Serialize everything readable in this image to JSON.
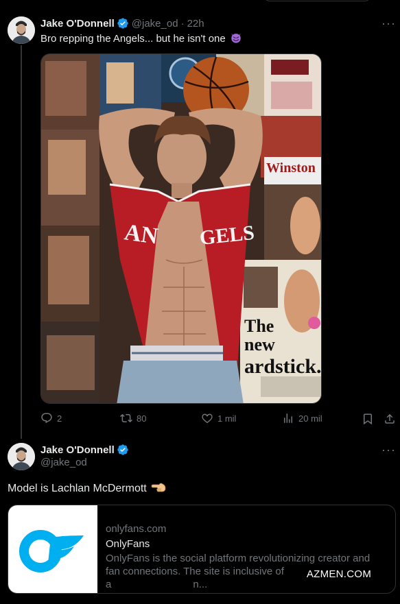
{
  "tweet": {
    "author_name": "Jake O'Donnell",
    "handle": "@jake_od",
    "separator": "·",
    "time": "22h",
    "text": "Bro repping the Angels... but he isn't one",
    "media": {
      "jersey_text_left": "AN",
      "jersey_text_right": "GELS",
      "poster_text_winston": "Winston",
      "poster_text_the": "The",
      "poster_text_new": "new",
      "poster_text_yardstick": "ardstick."
    },
    "stats": {
      "replies": "2",
      "reposts": "80",
      "likes": "1 mil",
      "views": "20 mil"
    }
  },
  "reply": {
    "author_name": "Jake O'Donnell",
    "handle": "@jake_od",
    "text": "Model is Lachlan McDermott",
    "card": {
      "domain": "onlyfans.com",
      "title": "OnlyFans",
      "description_line1": "OnlyFans is the social platform revolutionizing creator and",
      "description_line2": "fan connections. The site is inclusive of a",
      "description_tail": "n..."
    }
  },
  "watermark": "AZMEN.COM",
  "colors": {
    "background": "#000000",
    "text_primary": "#e7e9ea",
    "text_secondary": "#71767b",
    "verified_blue": "#1d9bf0",
    "border": "#2f3336",
    "onlyfans_blue": "#00aff0"
  }
}
